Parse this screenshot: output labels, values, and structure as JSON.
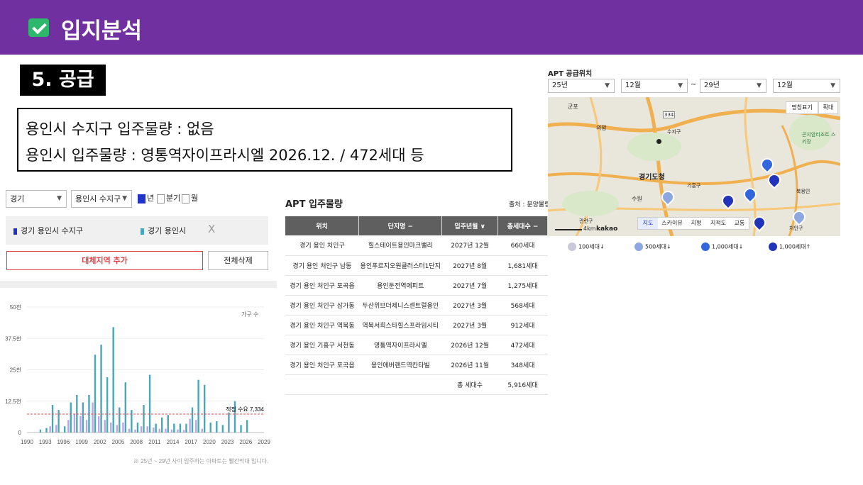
{
  "header": {
    "title": "입지분석"
  },
  "section": {
    "label": "5. 공급"
  },
  "summary": {
    "line1": "용인시 수지구 입주물량 : 없음",
    "line2": "용인시 입주물량 : 영통역자이프라시엘 2026.12. / 472세대 등"
  },
  "filter": {
    "region": "경기",
    "district": "용인시 수지구",
    "period_options": [
      "년",
      "분기",
      "월"
    ],
    "period_selected": "년"
  },
  "compare": {
    "tags": [
      {
        "label": "경기 용인시 수지구",
        "color": "#2233cc"
      },
      {
        "label": "경기 용인시",
        "color": "#4ba7b8"
      }
    ],
    "remove": "X",
    "add_button": "대체지역 추가",
    "delete_button": "전체삭제"
  },
  "chart_data": {
    "type": "bar",
    "legend": "가구 수",
    "ytick_labels": [
      "50천",
      "37.5천",
      "25천",
      "12.5천",
      "0"
    ],
    "ylim": [
      0,
      50000
    ],
    "xtick_labels": [
      "1990",
      "1993",
      "1996",
      "1999",
      "2002",
      "2005",
      "2008",
      "2011",
      "2014",
      "2017",
      "2020",
      "2023",
      "2026",
      "2029"
    ],
    "reference_label": "적정 수요 7,334",
    "reference_value": 7334,
    "series": [
      {
        "name": "경기 용인시",
        "color": "#4ba7b8",
        "years": [
          1990,
          1991,
          1992,
          1993,
          1994,
          1995,
          1996,
          1997,
          1998,
          1999,
          2000,
          2001,
          2002,
          2003,
          2004,
          2005,
          2006,
          2007,
          2008,
          2009,
          2010,
          2011,
          2012,
          2013,
          2014,
          2015,
          2016,
          2017,
          2018,
          2019,
          2020,
          2021,
          2022,
          2023,
          2024,
          2025,
          2026,
          2027
        ],
        "values": [
          0,
          0,
          1200,
          1800,
          11000,
          9000,
          2500,
          12000,
          15000,
          12000,
          15000,
          31000,
          35000,
          22000,
          42000,
          10000,
          20000,
          9000,
          4000,
          11000,
          23000,
          3500,
          6000,
          7000,
          3500,
          3500,
          3500,
          10000,
          21000,
          19000,
          4000,
          4500,
          3000,
          8000,
          12500,
          3000,
          5000,
          0
        ]
      },
      {
        "name": "경기 용인시 수지구",
        "color": "#b4a8e6",
        "years": [
          1994,
          1995,
          1997,
          1998,
          1999,
          2000,
          2001,
          2002,
          2003,
          2004,
          2005,
          2006,
          2007,
          2008,
          2009,
          2010,
          2011,
          2012,
          2013,
          2014,
          2015,
          2016,
          2017,
          2018,
          2019
        ],
        "values": [
          2500,
          3000,
          5000,
          7500,
          6500,
          5000,
          12000,
          6500,
          5000,
          4000,
          3000,
          4000,
          1500,
          1200,
          2500,
          2500,
          2000,
          1500,
          1500,
          1200,
          1200,
          1000,
          5500,
          5000,
          1500
        ]
      }
    ],
    "footnote": "※ 25년 ~ 29년 사이 입주하는 아파트는 빨간막대 입니다."
  },
  "table": {
    "title": "APT 입주물량",
    "source": "출처 : 분양물량조사",
    "headers": [
      "위치",
      "단지명 −",
      "입주년월 ∨",
      "총세대수 −"
    ],
    "rows": [
      [
        "경기 용인 처인구",
        "힐스테이트용인마크밸리",
        "2027년 12월",
        "660세대"
      ],
      [
        "경기 용인 처인구 남동",
        "용인푸르지오원클러스터1단지",
        "2027년 8월",
        "1,681세대"
      ],
      [
        "경기 용인 처인구 포곡읍",
        "용인둔전역에피트",
        "2027년 7월",
        "1,275세대"
      ],
      [
        "경기 용인 처인구 삼가동",
        "두산위브더제니스센트럴용인",
        "2027년 3월",
        "568세대"
      ],
      [
        "경기 용인 처인구 역북동",
        "역북서희스타힐스프라임시티",
        "2027년 3월",
        "912세대"
      ],
      [
        "경기 용인 기흥구 서천동",
        "영통역자이프라시엘",
        "2026년 12월",
        "472세대"
      ],
      [
        "경기 용인 처인구 포곡읍",
        "용인에버랜드역칸타빌",
        "2026년 11월",
        "348세대"
      ]
    ],
    "total_label": "총 세대수",
    "total_value": "5,916세대"
  },
  "map": {
    "title": "APT 공급위치",
    "from_year": "25년",
    "from_month": "12월",
    "tilde": "~",
    "to_year": "29년",
    "to_month": "12월",
    "buttons": [
      "명칭표기",
      "확대"
    ],
    "tabs": [
      "지도",
      "스카이뷰",
      "지형",
      "지적도",
      "교통"
    ],
    "kakao": "kakao",
    "scale": "4km",
    "labels": [
      "군포",
      "의왕",
      "수지구",
      "경기도청",
      "수원",
      "기흥구",
      "처인구",
      "관련구",
      "권선구",
      "용인",
      "북용인",
      "곤지암리조트 스키장",
      "영통구",
      "334"
    ],
    "legend": [
      "100세대↓",
      "500세대↓",
      "1,000세대↓",
      "1,000세대↑"
    ],
    "legend_colors": [
      "#c9c9d9",
      "#8da8e0",
      "#3366dd",
      "#2233bb"
    ]
  }
}
